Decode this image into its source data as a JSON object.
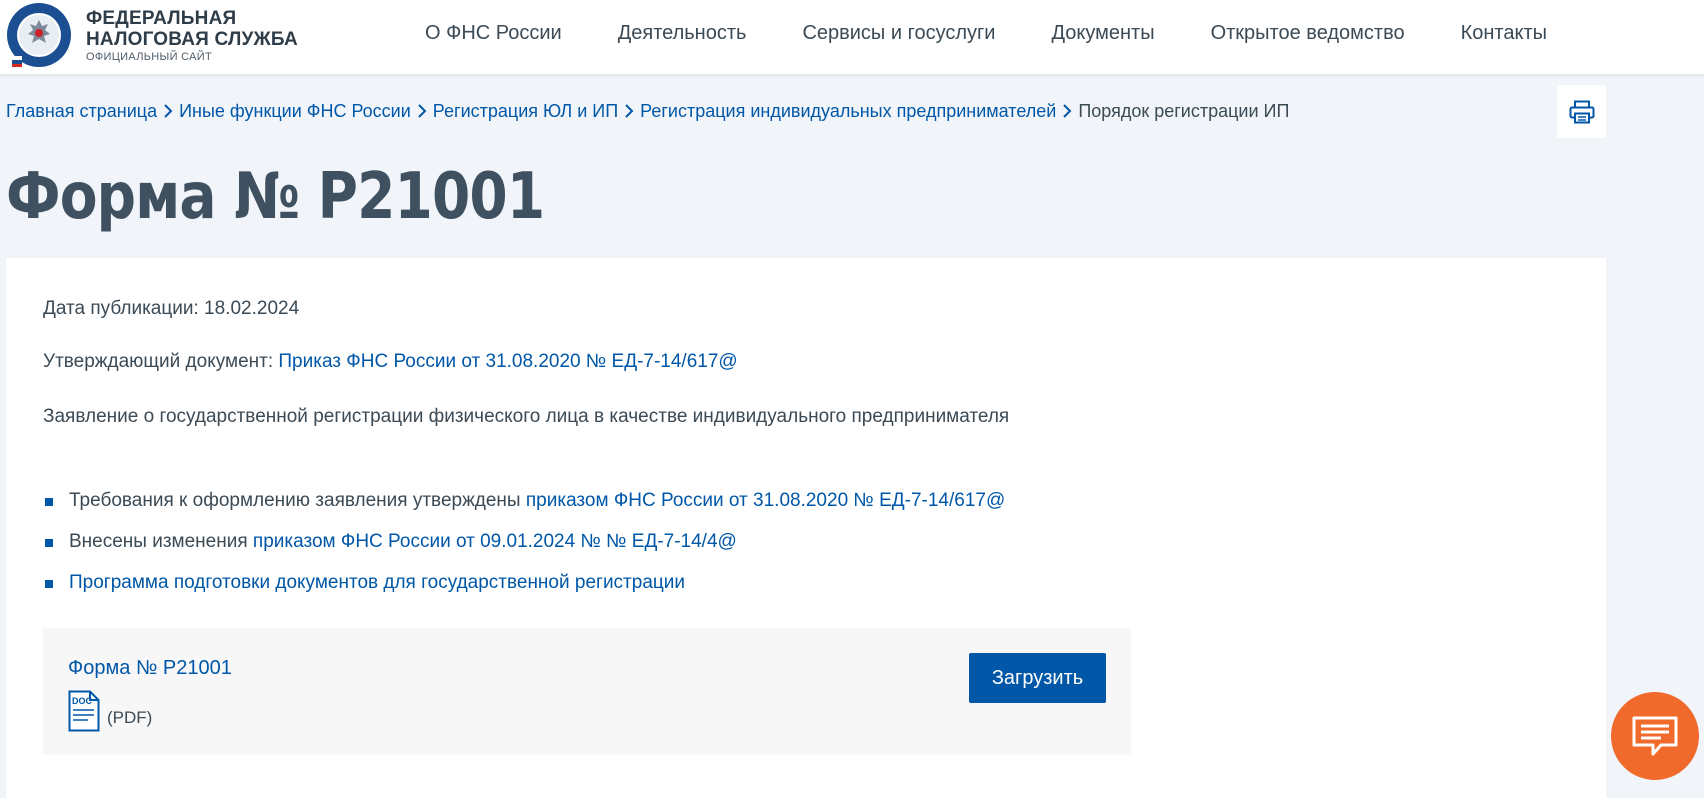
{
  "header": {
    "brand_line1": "ФЕДЕРАЛЬНАЯ",
    "brand_line2": "НАЛОГОВАЯ СЛУЖБА",
    "brand_sub": "ОФИЦИАЛЬНЫЙ САЙТ",
    "nav": [
      "О ФНС России",
      "Деятельность",
      "Сервисы и госуслуги",
      "Документы",
      "Открытое ведомство",
      "Контакты"
    ]
  },
  "breadcrumb": {
    "items": [
      "Главная страница",
      "Иные функции ФНС России",
      "Регистрация ЮЛ и ИП",
      "Регистрация индивидуальных предпринимателей"
    ],
    "current": "Порядок регистрации ИП"
  },
  "page": {
    "title": "Форма № Р21001",
    "pub_date": "Дата публикации: 18.02.2024",
    "approving_label": "Утверждающий документ:",
    "approving_link": "Приказ ФНС России от 31.08.2020 № ЕД-7-14/617@",
    "description": "Заявление о государственной регистрации физического лица в качестве индивидуального предпринимателя",
    "bullets": [
      {
        "text": "Требования к оформлению заявления утверждены ",
        "link": "приказом ФНС России от 31.08.2020 № ЕД-7-14/617@"
      },
      {
        "text": "Внесены изменения ",
        "link": "приказом ФНС России от 09.01.2024 № № ЕД-7-14/4@"
      },
      {
        "text": "",
        "link": "Программа подготовки документов для государственной регистрации"
      }
    ]
  },
  "file": {
    "title": "Форма № Р21001",
    "icon_label": "DOC",
    "type": "(PDF)",
    "download_label": "Загрузить"
  },
  "colors": {
    "accent": "#0057a8",
    "background": "#f1f5fa",
    "chat": "#f06a2b"
  }
}
